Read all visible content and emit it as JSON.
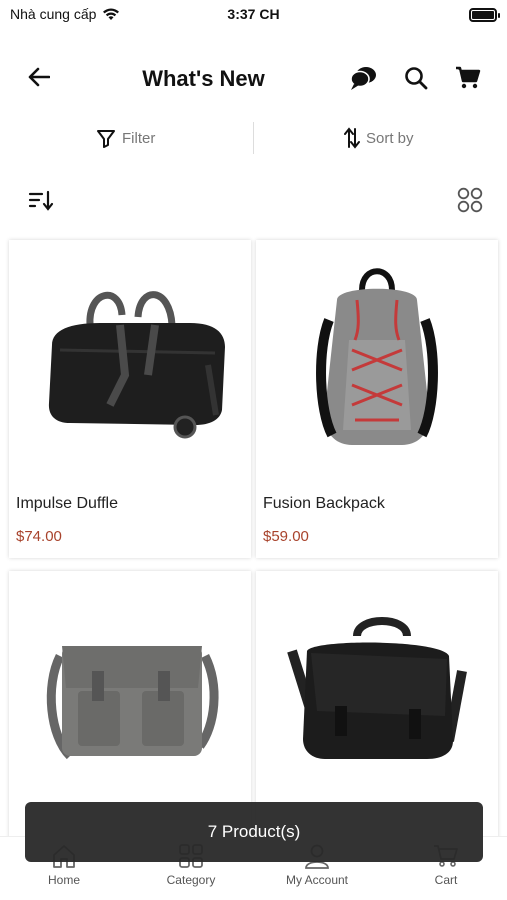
{
  "status_bar": {
    "carrier": "Nhà cung cấp",
    "time": "3:37 CH"
  },
  "header": {
    "title": "What's New"
  },
  "filter_bar": {
    "filter_label": "Filter",
    "sort_label": "Sort by"
  },
  "products": [
    {
      "name": "Impulse Duffle",
      "price": "$74.00"
    },
    {
      "name": "Fusion Backpack",
      "price": "$59.00"
    },
    {
      "name": "",
      "price": ""
    },
    {
      "name": "",
      "price": ""
    }
  ],
  "toast": {
    "message": "7 Product(s)"
  },
  "bottom_nav": [
    {
      "label": "Home",
      "icon": "home-icon"
    },
    {
      "label": "Category",
      "icon": "category-icon"
    },
    {
      "label": "My Account",
      "icon": "account-icon"
    },
    {
      "label": "Cart",
      "icon": "cart-icon"
    }
  ],
  "colors": {
    "price": "#a8432c",
    "toast_bg": "#282828",
    "muted_text": "#777777"
  }
}
